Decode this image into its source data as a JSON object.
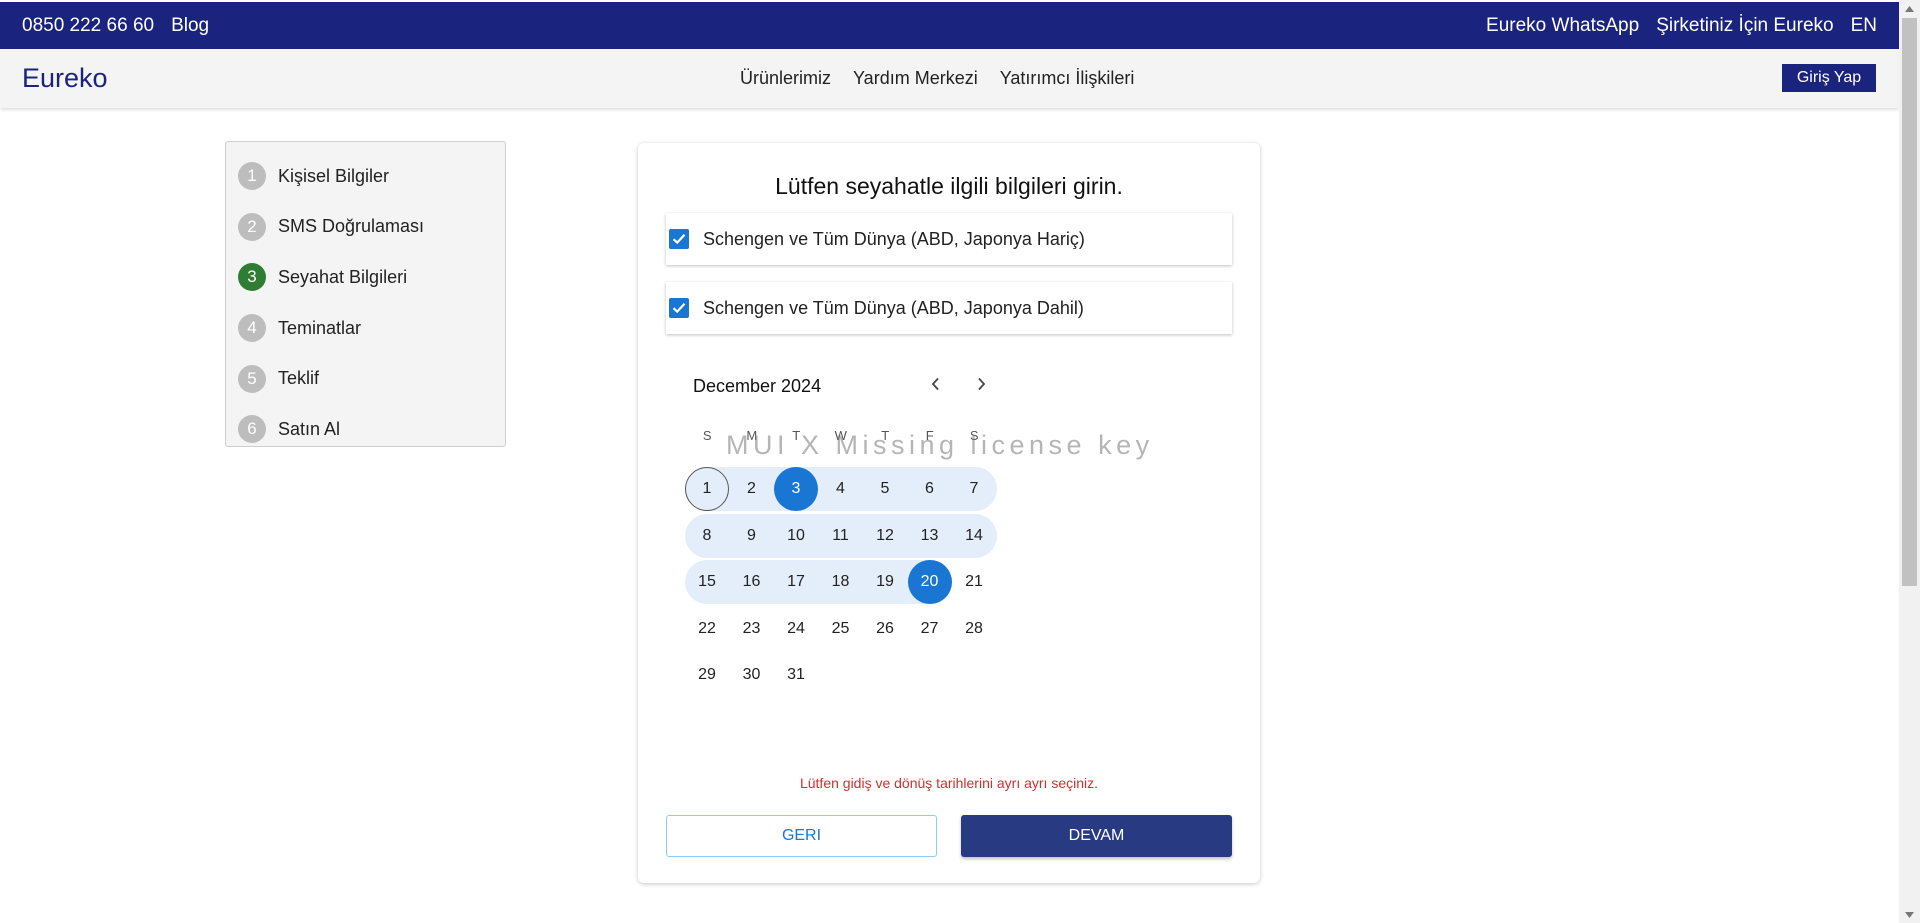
{
  "topbar": {
    "phone": "0850 222 66 60",
    "blog": "Blog",
    "whatsapp": "Eureko WhatsApp",
    "corporate": "Şirketiniz İçin Eureko",
    "lang": "EN"
  },
  "nav": {
    "logo": "Eureko",
    "menu": [
      "Ürünlerimiz",
      "Yardım Merkezi",
      "Yatırımcı İlişkileri"
    ],
    "login_label": "Giriş Yap"
  },
  "steps": [
    {
      "num": "1",
      "label": "Kişisel Bilgiler",
      "active": false
    },
    {
      "num": "2",
      "label": "SMS Doğrulaması",
      "active": false
    },
    {
      "num": "3",
      "label": "Seyahat Bilgileri",
      "active": true
    },
    {
      "num": "4",
      "label": "Teminatlar",
      "active": false
    },
    {
      "num": "5",
      "label": "Teklif",
      "active": false
    },
    {
      "num": "6",
      "label": "Satın Al",
      "active": false
    }
  ],
  "form": {
    "title": "Lütfen seyahatle ilgili bilgileri girin.",
    "options": [
      {
        "label": "Schengen ve Tüm Dünya (ABD, Japonya Hariç)",
        "checked": true
      },
      {
        "label": "Schengen ve Tüm Dünya (ABD, Japonya Dahil)",
        "checked": true
      }
    ],
    "error": "Lütfen gidiş ve dönüş tarihlerini ayrı ayrı seçiniz.",
    "back_label": "GERI",
    "next_label": "DEVAM"
  },
  "calendar": {
    "month_label": "December 2024",
    "weekdays": [
      "S",
      "M",
      "T",
      "W",
      "T",
      "F",
      "S"
    ],
    "first_weekday_index": 0,
    "days_in_month": 31,
    "today": 1,
    "range_start": 3,
    "range_end": 20,
    "watermark": "MUI X Missing license key"
  },
  "colors": {
    "brand": "#1a237e",
    "accent": "#1976d2",
    "step_active": "#2e7d32",
    "error": "#d32f2f"
  }
}
